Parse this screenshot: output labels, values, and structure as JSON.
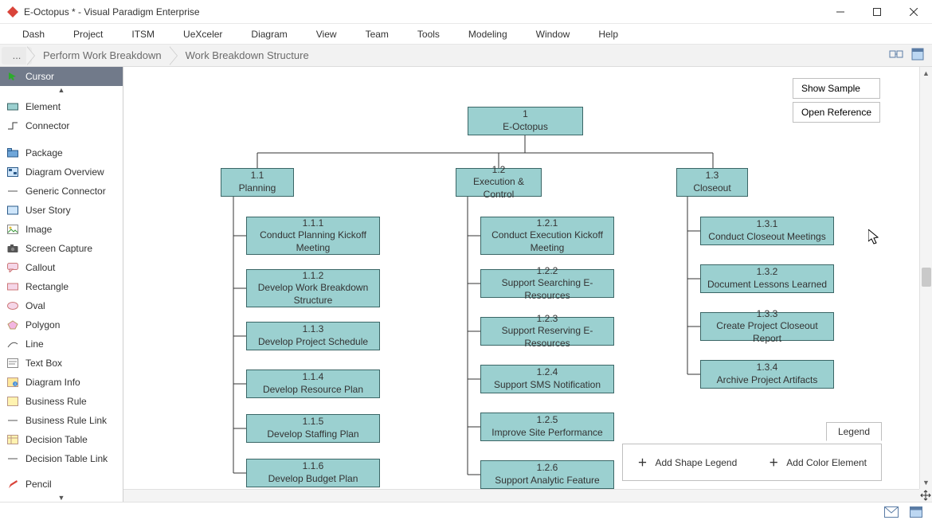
{
  "window": {
    "title": "E-Octopus * - Visual Paradigm Enterprise"
  },
  "menu": [
    "Dash",
    "Project",
    "ITSM",
    "UeXceler",
    "Diagram",
    "View",
    "Team",
    "Tools",
    "Modeling",
    "Window",
    "Help"
  ],
  "breadcrumb": {
    "ellipsis": "...",
    "seg1": "Perform Work Breakdown",
    "seg2": "Work Breakdown Structure"
  },
  "palette": {
    "cursor": "Cursor",
    "element": "Element",
    "connector": "Connector",
    "package": "Package",
    "diagram_overview": "Diagram Overview",
    "generic_connector": "Generic Connector",
    "user_story": "User Story",
    "image": "Image",
    "screen_capture": "Screen Capture",
    "callout": "Callout",
    "rectangle": "Rectangle",
    "oval": "Oval",
    "polygon": "Polygon",
    "line": "Line",
    "text_box": "Text Box",
    "diagram_info": "Diagram Info",
    "business_rule": "Business Rule",
    "business_rule_link": "Business Rule Link",
    "decision_table": "Decision Table",
    "decision_table_link": "Decision Table Link",
    "pencil": "Pencil"
  },
  "float": {
    "show_sample": "Show Sample",
    "open_reference": "Open Reference"
  },
  "legend": {
    "title": "Legend",
    "add_shape": "Add Shape Legend",
    "add_color": "Add Color Element"
  },
  "wbs": {
    "root": {
      "num": "1",
      "name": "E-Octopus"
    },
    "l1": [
      {
        "num": "1.1",
        "name": "Planning"
      },
      {
        "num": "1.2",
        "name": "Execution & Control"
      },
      {
        "num": "1.3",
        "name": "Closeout"
      }
    ],
    "planning": [
      {
        "num": "1.1.1",
        "name": "Conduct Planning Kickoff Meeting"
      },
      {
        "num": "1.1.2",
        "name": "Develop Work Breakdown Structure"
      },
      {
        "num": "1.1.3",
        "name": "Develop Project Schedule"
      },
      {
        "num": "1.1.4",
        "name": "Develop Resource Plan"
      },
      {
        "num": "1.1.5",
        "name": "Develop Staffing Plan"
      },
      {
        "num": "1.1.6",
        "name": "Develop Budget Plan"
      }
    ],
    "execution": [
      {
        "num": "1.2.1",
        "name": "Conduct Execution Kickoff Meeting"
      },
      {
        "num": "1.2.2",
        "name": "Support Searching E-Resources"
      },
      {
        "num": "1.2.3",
        "name": "Support Reserving E-Resources"
      },
      {
        "num": "1.2.4",
        "name": "Support SMS Notification"
      },
      {
        "num": "1.2.5",
        "name": "Improve Site Performance"
      },
      {
        "num": "1.2.6",
        "name": "Support Analytic Feature"
      }
    ],
    "closeout": [
      {
        "num": "1.3.1",
        "name": "Conduct Closeout Meetings"
      },
      {
        "num": "1.3.2",
        "name": "Document Lessons Learned"
      },
      {
        "num": "1.3.3",
        "name": "Create Project Closeout Report"
      },
      {
        "num": "1.3.4",
        "name": "Archive Project Artifacts"
      }
    ]
  }
}
